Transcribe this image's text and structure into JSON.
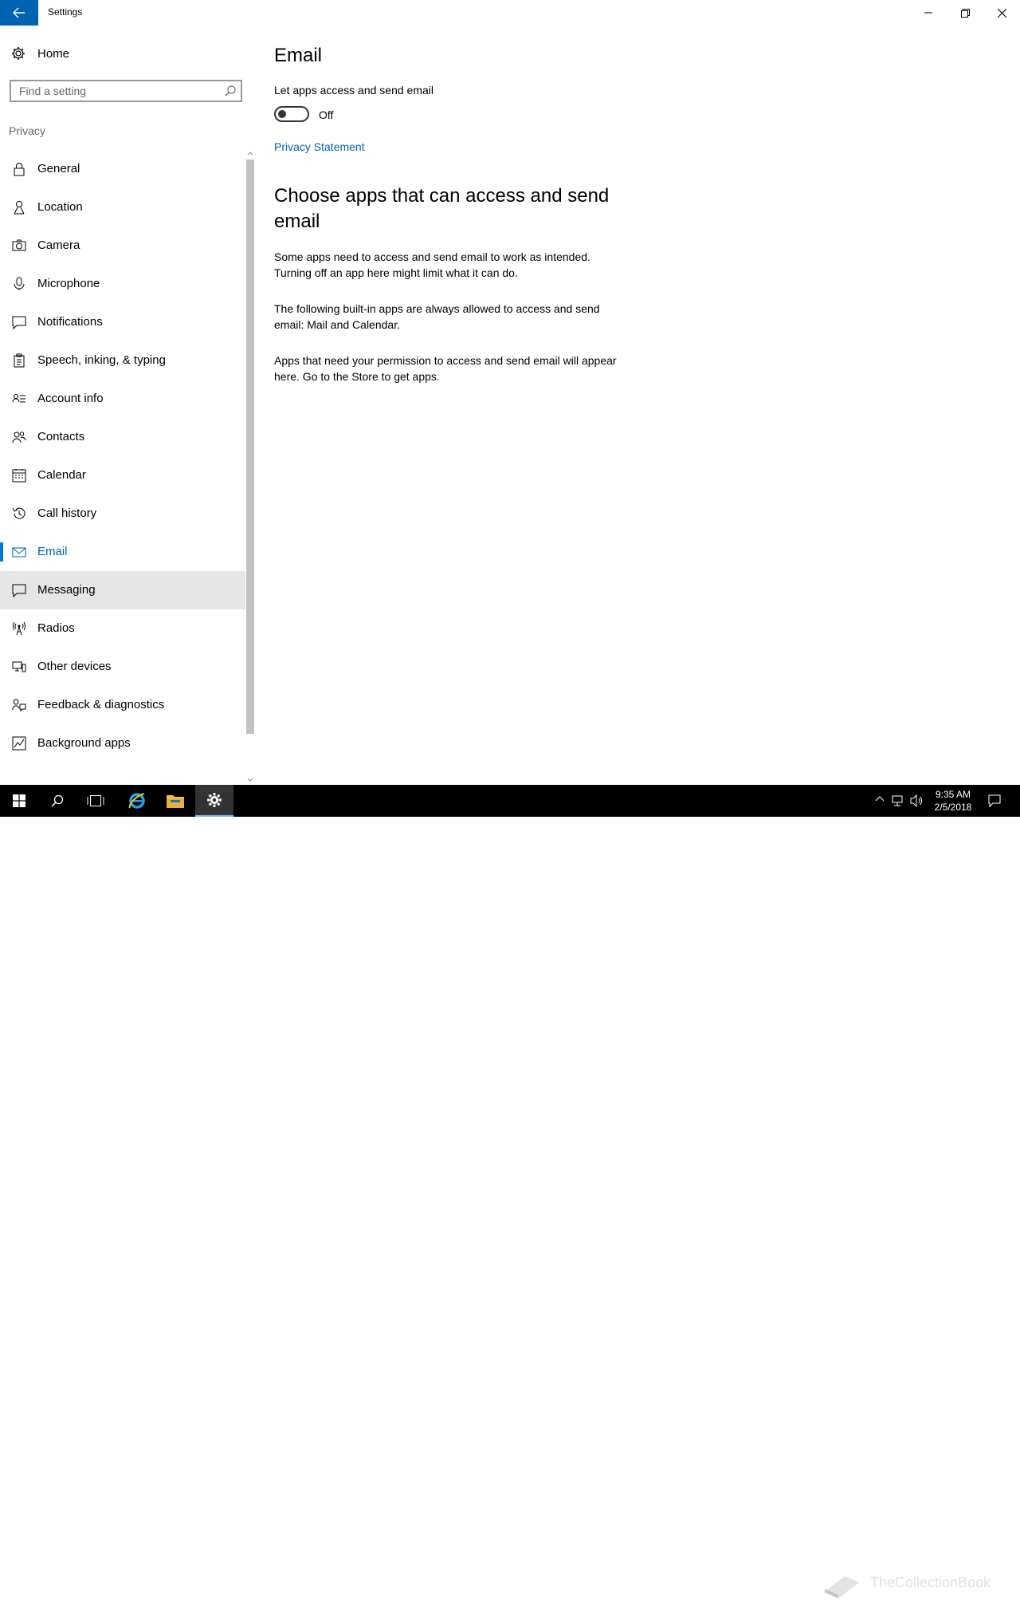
{
  "window": {
    "title": "Settings",
    "minimize": "minimize",
    "restore": "restore",
    "close": "close"
  },
  "sidebar": {
    "home_label": "Home",
    "search_placeholder": "Find a setting",
    "section": "Privacy",
    "items": [
      {
        "label": "General",
        "icon": "lock-icon"
      },
      {
        "label": "Location",
        "icon": "location-icon"
      },
      {
        "label": "Camera",
        "icon": "camera-icon"
      },
      {
        "label": "Microphone",
        "icon": "microphone-icon"
      },
      {
        "label": "Notifications",
        "icon": "notifications-icon"
      },
      {
        "label": "Speech, inking, & typing",
        "icon": "clipboard-icon"
      },
      {
        "label": "Account info",
        "icon": "account-info-icon"
      },
      {
        "label": "Contacts",
        "icon": "contacts-icon"
      },
      {
        "label": "Calendar",
        "icon": "calendar-icon"
      },
      {
        "label": "Call history",
        "icon": "history-icon"
      },
      {
        "label": "Email",
        "icon": "mail-icon",
        "active": true
      },
      {
        "label": "Messaging",
        "icon": "message-icon",
        "hover": true
      },
      {
        "label": "Radios",
        "icon": "radio-tower-icon"
      },
      {
        "label": "Other devices",
        "icon": "devices-icon"
      },
      {
        "label": "Feedback & diagnostics",
        "icon": "feedback-icon"
      },
      {
        "label": "Background apps",
        "icon": "background-apps-icon"
      }
    ]
  },
  "content": {
    "title": "Email",
    "toggle_label": "Let apps access and send email",
    "toggle_state": "Off",
    "toggle_on": false,
    "privacy_link": "Privacy Statement",
    "section_title": "Choose apps that can access and send email",
    "para1": "Some apps need to access and send email to work as intended. Turning off an app here might limit what it can do.",
    "para2": "The following built-in apps are always allowed to access and send email: Mail and Calendar.",
    "para3": "Apps that need your permission to access and send email will appear here. Go to the Store to get apps."
  },
  "taskbar": {
    "time": "9:35 AM",
    "date": "2/5/2018",
    "watermark": "TheCollectionBook",
    "accent": "#0078d7"
  }
}
